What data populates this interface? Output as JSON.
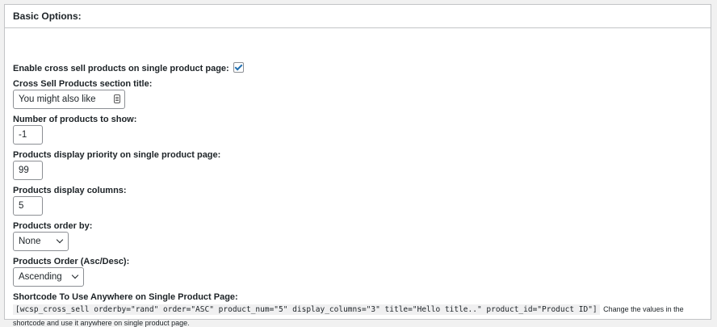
{
  "panel": {
    "title": "Basic Options:"
  },
  "fields": {
    "enable_cross_sell_label": "Enable cross sell products on single product page:",
    "enable_cross_sell_checked": true,
    "section_title_label": "Cross Sell Products section title:",
    "section_title_value": "You might also like",
    "num_products_label": "Number of products to show:",
    "num_products_value": "-1",
    "priority_label": "Products display priority on single product page:",
    "priority_value": "99",
    "columns_label": "Products display columns:",
    "columns_value": "5",
    "order_by_label": "Products order by:",
    "order_by_value": "None",
    "order_label": "Products Order (Asc/Desc):",
    "order_value": "Ascending"
  },
  "shortcode": {
    "label": "Shortcode To Use Anywhere on Single Product Page:",
    "code": "[wcsp_cross_sell orderby=\"rand\" order=\"ASC\" product_num=\"5\" display_columns=\"3\" title=\"Hello title..\" product_id=\"Product ID\"]",
    "note_part1": "Change the values in the",
    "note_part2": "shortcode and use it anywhere on single product page."
  },
  "icons": {
    "checkbox": "checkmark-icon",
    "autofill": "contact-card-icon",
    "select": "chevron-down-icon"
  },
  "colors": {
    "accent": "#2271b1",
    "border": "#8c8f94",
    "background": "#f1f1f1"
  }
}
